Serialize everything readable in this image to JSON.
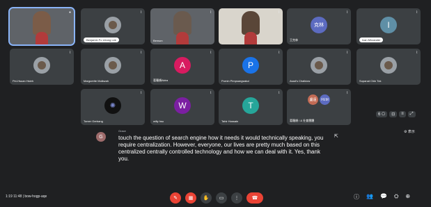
{
  "tiles": [
    {
      "name": "",
      "type": "self",
      "mic": "●"
    },
    {
      "name": "Benjamin Fo Ueong Lee",
      "type": "photo",
      "pill": true,
      "mic": "⌇"
    },
    {
      "name": "Benson",
      "type": "video",
      "mic": "⌇"
    },
    {
      "name": "",
      "type": "video",
      "mic": "⌇"
    },
    {
      "name": "王克林",
      "type": "letter",
      "letter": "克林",
      "color": "#5c6bc0",
      "mic": "⌇"
    },
    {
      "name": "Ivan Mirzander",
      "type": "letter",
      "letter": "I",
      "color": "#5f8fa6",
      "pill": true,
      "mic": "⌇"
    },
    {
      "name": "Pei-Hsuan Hsieh",
      "type": "photo",
      "mic": "⌇"
    },
    {
      "name": "Marguerite Mulkwah",
      "type": "photo",
      "mic": "⌇"
    },
    {
      "name": "葛羅順Akira",
      "type": "letter",
      "letter": "A",
      "color": "#d81b60",
      "mic": "⌇"
    },
    {
      "name": "Purnin Pimpsangsakul",
      "type": "letter",
      "letter": "P",
      "color": "#1a73e8",
      "mic": "⌇"
    },
    {
      "name": "Asad's Chalkiow",
      "type": "photo",
      "mic": "⌇"
    },
    {
      "name": "Supanat Chin Tok",
      "type": "photo",
      "mic": "⌇"
    },
    {
      "name": "Tomer Gerbang",
      "type": "photo",
      "mic": "⌇"
    },
    {
      "name": "willy hsu",
      "type": "letter",
      "letter": "W",
      "color": "#7b1fa2",
      "mic": "⌇"
    },
    {
      "name": "Tahir Hussain",
      "type": "letter",
      "letter": "T",
      "color": "#26a69a",
      "mic": "⌇"
    },
    {
      "name": "葛羅順 / & 社會團體",
      "type": "dual",
      "letters": [
        "盧遠",
        "FEM"
      ],
      "mic": "⌇"
    }
  ],
  "caption": {
    "avatar_letter": "G",
    "speaker": "Grace",
    "text": "touch the question of search engine how it needs it would technically speaking, you require centralization. However, everyone, our lives are pretty much based on this centralized centrally controlled technology and how we can deal with it. Yes, thank you."
  },
  "side_controls": [
    "6 ⎔",
    "⊡",
    "≡",
    "⤢"
  ],
  "hide_captions": "⚙ 表示",
  "cursor": "⇱",
  "meeting_info": "1:19 11:48  |  bow-hogp-aqe",
  "controls": [
    {
      "icon": "✎",
      "red": true
    },
    {
      "icon": "▦",
      "red": true
    },
    {
      "icon": "✋",
      "red": false
    },
    {
      "icon": "▭",
      "red": false
    },
    {
      "icon": "⋮",
      "red": false
    },
    {
      "icon": "☎",
      "red": true,
      "end": true
    }
  ],
  "right_controls": [
    "ⓘ",
    "👥",
    "💬",
    "⛭",
    "⊕"
  ]
}
